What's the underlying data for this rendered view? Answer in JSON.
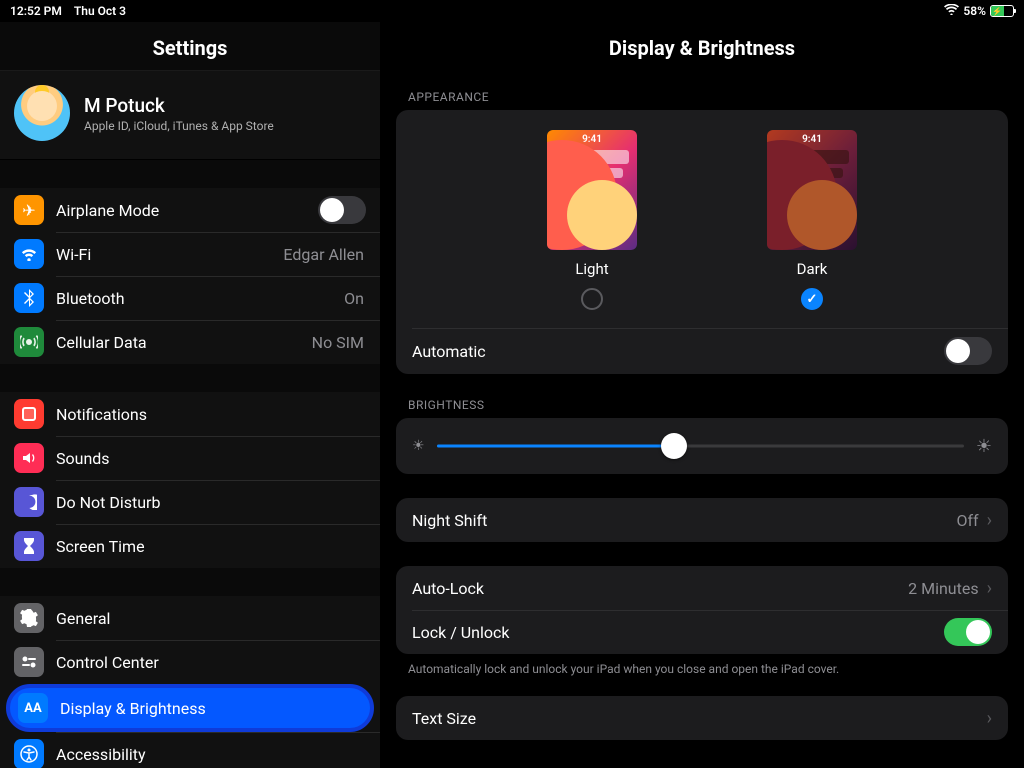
{
  "status": {
    "time": "12:52 PM",
    "date": "Thu Oct 3",
    "battery_pct": "58%"
  },
  "sidebar": {
    "title": "Settings",
    "profile": {
      "name": "M Potuck",
      "sub": "Apple ID, iCloud, iTunes & App Store"
    },
    "g1": {
      "airplane": "Airplane Mode",
      "wifi": "Wi-Fi",
      "wifi_val": "Edgar Allen",
      "bt": "Bluetooth",
      "bt_val": "On",
      "cell": "Cellular Data",
      "cell_val": "No SIM"
    },
    "g2": {
      "notif": "Notifications",
      "sounds": "Sounds",
      "dnd": "Do Not Disturb",
      "st": "Screen Time"
    },
    "g3": {
      "general": "General",
      "cc": "Control Center",
      "db": "Display & Brightness",
      "acc": "Accessibility"
    }
  },
  "detail": {
    "title": "Display & Brightness",
    "appearance_label": "APPEARANCE",
    "light": "Light",
    "dark": "Dark",
    "thumb_time": "9:41",
    "automatic": "Automatic",
    "brightness_label": "BRIGHTNESS",
    "brightness_pct": 45,
    "nightshift": "Night Shift",
    "nightshift_val": "Off",
    "autolock": "Auto-Lock",
    "autolock_val": "2 Minutes",
    "lockunlock": "Lock / Unlock",
    "lock_note": "Automatically lock and unlock your iPad when you close and open the iPad cover.",
    "textsize": "Text Size"
  }
}
